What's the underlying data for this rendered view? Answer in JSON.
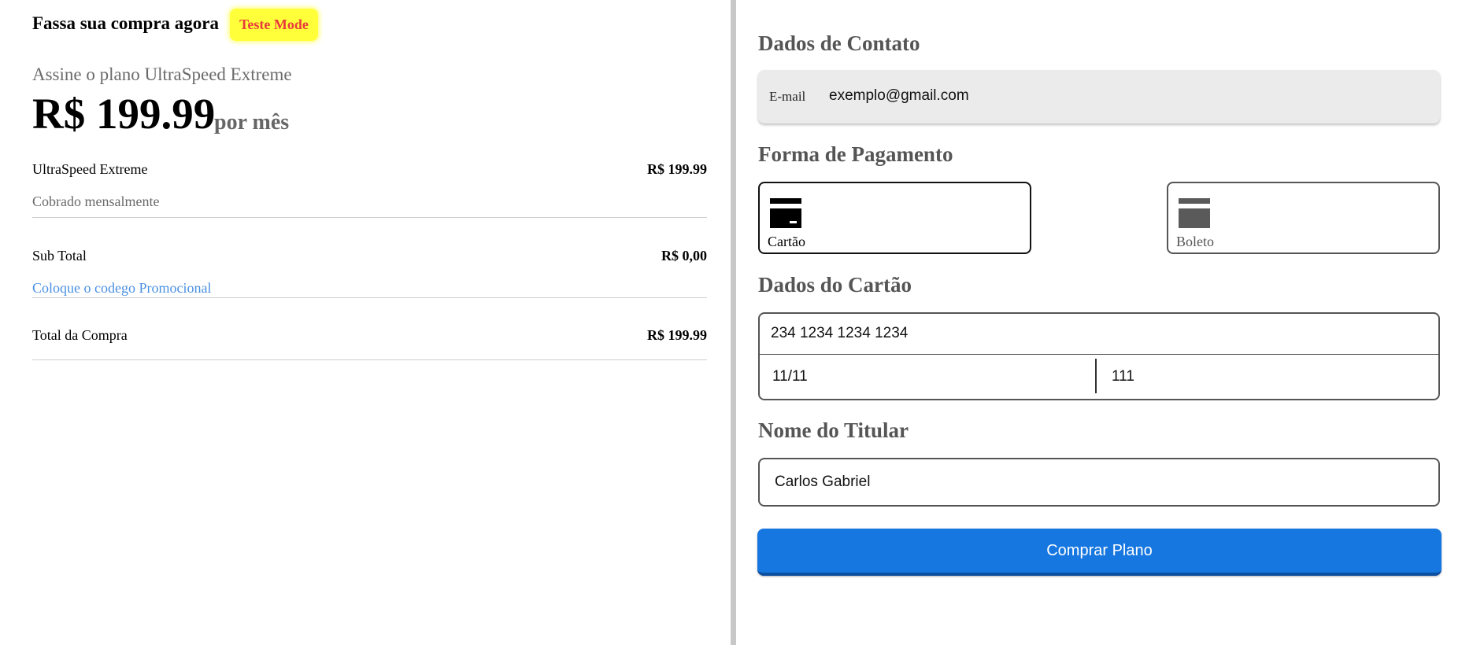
{
  "summary": {
    "store_title": "Fassa sua compra agora",
    "test_badge": "Teste Mode",
    "plan_subtitle": "Assine o plano UltraSpeed Extreme",
    "price": "R$ 199.99",
    "period": "por mês",
    "item": {
      "name": "UltraSpeed Extreme",
      "value": "R$ 199.99",
      "note": "Cobrado mensalmente"
    },
    "subtotal": {
      "label": "Sub Total",
      "value": "R$ 0,00"
    },
    "promo_link": "Coloque o codego Promocional",
    "total": {
      "label": "Total da Compra",
      "value": "R$ 199.99"
    }
  },
  "contact": {
    "title": "Dados de Contato",
    "email_label": "E-mail",
    "email_value": "exemplo@gmail.com"
  },
  "payment": {
    "title": "Forma de Pagamento",
    "methods": [
      {
        "label": "Cartão",
        "icon": "credit-card-icon",
        "selected": true
      },
      {
        "label": "Boleto",
        "icon": "boleto-icon",
        "selected": false
      }
    ]
  },
  "card": {
    "title": "Dados do Cartão",
    "number": "234 1234 1234 1234",
    "expiry": "11/11",
    "cvc": "111"
  },
  "holder": {
    "title": "Nome do Titular",
    "name": "Carlos Gabriel"
  },
  "submit_label": "Comprar Plano",
  "colors": {
    "primary": "#1677e0",
    "badge_bg": "#ffff3a",
    "badge_text": "#e83b3b",
    "link": "#4a90e2",
    "divider": "#c8c8c8"
  }
}
